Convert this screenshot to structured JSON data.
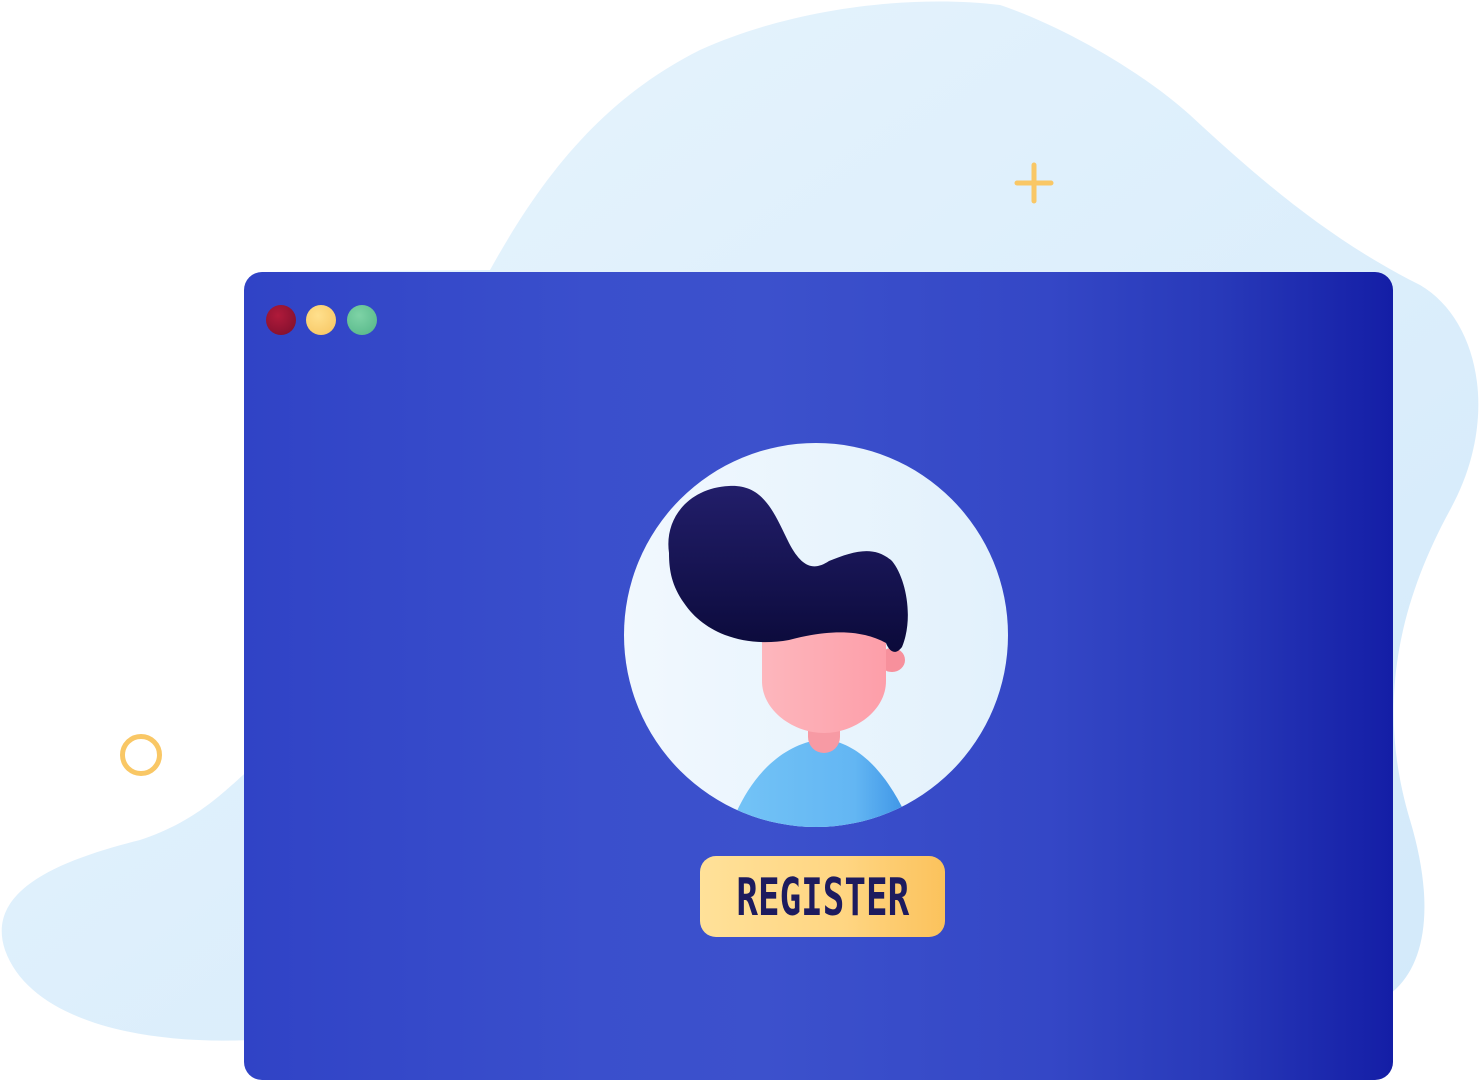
{
  "button": {
    "label": "REGISTER"
  },
  "window_controls": [
    {
      "name": "close",
      "color": "#8f1431"
    },
    {
      "name": "minimize",
      "color": "#fdd27a"
    },
    {
      "name": "maximize",
      "color": "#67c497"
    }
  ],
  "colors": {
    "window_background": "#3a4fcc",
    "blob_background": "#dbeefb",
    "button_background": "#ffd581",
    "button_text": "#1d1b5e",
    "accent_yellow": "#f9c765",
    "avatar_circle": "#eef6fd",
    "hair": "#171450",
    "skin": "#fdaab2",
    "shirt": "#6bbaf2"
  },
  "icons": {
    "avatar": "user-avatar-icon",
    "plus": "plus-icon",
    "ring": "ring-icon"
  }
}
